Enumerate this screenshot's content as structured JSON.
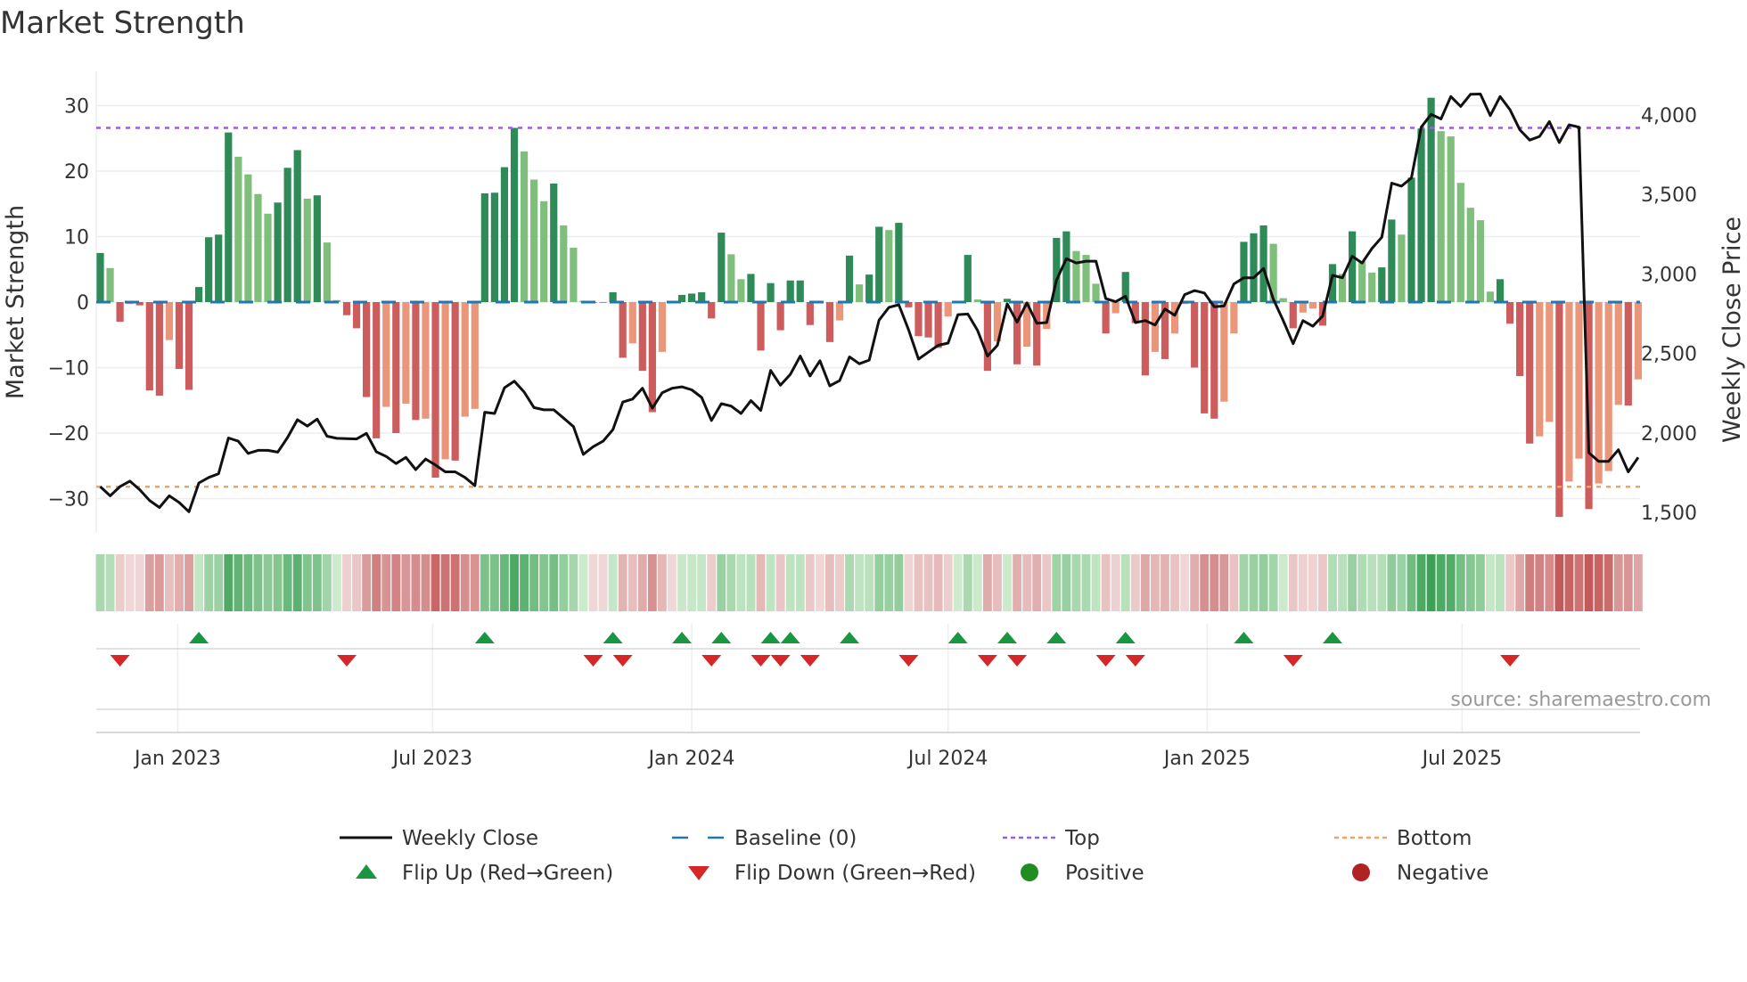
{
  "chart_data": {
    "type": "bar",
    "title": "Market Strength",
    "ylabel": "Market Strength",
    "y2label": "Weekly Close Price",
    "start_week": "2022-11-07",
    "frequency": "weekly",
    "ylim": [
      -35,
      36
    ],
    "y2lim": [
      1375,
      4200
    ],
    "yticks": [
      30,
      20,
      10,
      0,
      -10,
      -20,
      -30
    ],
    "ytick_labels": [
      "30",
      "20",
      "10",
      "0",
      "−10",
      "−20",
      "−30"
    ],
    "y2ticks": [
      4000,
      3500,
      3000,
      2500,
      2000,
      1500
    ],
    "y2tick_labels": [
      "4,000",
      "3,500",
      "3,000",
      "2,500",
      "2,000",
      "1,500"
    ],
    "xticks": [
      {
        "date": "2023-01-01",
        "label": "Jan 2023"
      },
      {
        "date": "2023-07-01",
        "label": "Jul 2023"
      },
      {
        "date": "2024-01-01",
        "label": "Jan 2024"
      },
      {
        "date": "2024-07-01",
        "label": "Jul 2024"
      },
      {
        "date": "2025-01-01",
        "label": "Jan 2025"
      },
      {
        "date": "2025-07-01",
        "label": "Jul 2025"
      }
    ],
    "top_level": 26.6,
    "bottom_level": -28.2,
    "strength": [
      7.5,
      5.2,
      -3,
      -0.3,
      -0.5,
      -13.5,
      -14.3,
      -5.8,
      -10.2,
      -13.4,
      2.3,
      9.9,
      10.3,
      25.9,
      22.2,
      19.5,
      16.5,
      13.5,
      15.2,
      20.5,
      23.2,
      15.8,
      16.3,
      9.1,
      0.3,
      -2,
      -4,
      -14.5,
      -20.8,
      -16,
      -20,
      -15.5,
      -18,
      -17.8,
      -26.8,
      -24,
      -24.2,
      -17.5,
      -16.3,
      16.6,
      16.7,
      20.6,
      26.6,
      23,
      18.7,
      15.4,
      18.1,
      11.7,
      8.3,
      0.2,
      -0.1,
      -0.1,
      1.5,
      -8.5,
      -6.3,
      -10.5,
      -16.8,
      -7.6,
      -0.2,
      1.1,
      1.3,
      1.5,
      -2.5,
      10.6,
      7.3,
      3.5,
      4.3,
      -7.4,
      2.9,
      -4.3,
      3.3,
      3.3,
      -3.5,
      -0.2,
      -6.1,
      -2.8,
      7.1,
      2.7,
      4.2,
      11.5,
      11,
      12.1,
      -0.8,
      -5.2,
      -5.4,
      -7,
      -2.2,
      0.1,
      7.2,
      0.4,
      -10.5,
      -6,
      0.5,
      -9.5,
      -6.8,
      -9.7,
      -4.1,
      9.8,
      10.8,
      7.8,
      7.2,
      2.8,
      -4.8,
      -1.7,
      4.6,
      -3.2,
      -11.2,
      -7.6,
      -8.7,
      -4.8,
      -0.3,
      -10,
      -17,
      -17.8,
      -15.2,
      -4.8,
      9.2,
      10.5,
      11.7,
      8.9,
      0.6,
      -4,
      -1.6,
      -1,
      -3.6,
      5.8,
      4.3,
      10.8,
      6.2,
      4.5,
      5.3,
      12.6,
      10.3,
      19,
      26.5,
      31.2,
      26.1,
      25.3,
      18.2,
      14.4,
      12.5,
      1.6,
      3.5,
      -3.3,
      -11.3,
      -21.6,
      -20.5,
      -18.3,
      -32.8,
      -27.4,
      -23.9,
      -31.6,
      -27.7,
      -25.8,
      -15.7,
      -15.8,
      -11.8
    ],
    "weekly_close": [
      1662,
      1604,
      1662,
      1697,
      1643,
      1575,
      1531,
      1604,
      1562,
      1504,
      1685,
      1720,
      1743,
      1968,
      1948,
      1871,
      1890,
      1890,
      1879,
      1971,
      2083,
      2043,
      2087,
      1979,
      1966,
      1964,
      1962,
      1997,
      1881,
      1852,
      1807,
      1846,
      1769,
      1836,
      1798,
      1755,
      1755,
      1720,
      1668,
      2130,
      2122,
      2284,
      2325,
      2257,
      2159,
      2145,
      2145,
      2093,
      2039,
      1865,
      1913,
      1948,
      2020,
      2194,
      2213,
      2281,
      2155,
      2252,
      2281,
      2290,
      2271,
      2223,
      2078,
      2184,
      2169,
      2122,
      2203,
      2141,
      2393,
      2300,
      2368,
      2483,
      2358,
      2454,
      2296,
      2329,
      2478,
      2435,
      2458,
      2709,
      2790,
      2806,
      2648,
      2464,
      2508,
      2551,
      2565,
      2744,
      2748,
      2644,
      2483,
      2551,
      2812,
      2696,
      2818,
      2690,
      2694,
      2961,
      3096,
      3069,
      3080,
      3080,
      2845,
      2825,
      2860,
      2694,
      2706,
      2679,
      2779,
      2740,
      2870,
      2895,
      2880,
      2793,
      2798,
      2937,
      2976,
      2976,
      3034,
      2841,
      2706,
      2561,
      2706,
      2671,
      2735,
      2991,
      2976,
      3111,
      3069,
      3160,
      3231,
      3571,
      3552,
      3604,
      3923,
      4004,
      3975,
      4116,
      4054,
      4130,
      4132,
      3996,
      4116,
      4033,
      3907,
      3842,
      3865,
      3958,
      3826,
      3938,
      3923,
      1875,
      1821,
      1821,
      1894,
      1755,
      1846
    ],
    "flip_up_indices": [
      10,
      39,
      52,
      59,
      63,
      68,
      70,
      76,
      87,
      92,
      97,
      104,
      116,
      125
    ],
    "flip_down_indices": [
      2,
      25,
      50,
      53,
      62,
      67,
      69,
      72,
      82,
      90,
      93,
      102,
      105,
      121,
      143
    ],
    "legend": [
      {
        "label": "Weekly Close",
        "kind": "line"
      },
      {
        "label": "Baseline (0)",
        "kind": "dash"
      },
      {
        "label": "Top",
        "kind": "dotted-top"
      },
      {
        "label": "Bottom",
        "kind": "dotted-bottom"
      },
      {
        "label": "Flip Up (Red→Green)",
        "kind": "triangle-up"
      },
      {
        "label": "Flip Down (Green→Red)",
        "kind": "triangle-down"
      },
      {
        "label": "Positive",
        "kind": "circle-pos"
      },
      {
        "label": "Negative",
        "kind": "circle-neg"
      }
    ],
    "source": "source: sharemaestro.com",
    "colors": {
      "pos_rising": "#2e8b57",
      "pos_falling": "#7fbf7b",
      "neg_falling": "#cd5c5c",
      "neg_rising": "#e9967a",
      "baseline": "#1f77b4",
      "top": "#9b5de5",
      "bottom": "#f0a35e",
      "price": "#111111",
      "flip_up": "#1a9641",
      "flip_down": "#d62728",
      "positive": "#228b22",
      "negative": "#b22222"
    }
  }
}
